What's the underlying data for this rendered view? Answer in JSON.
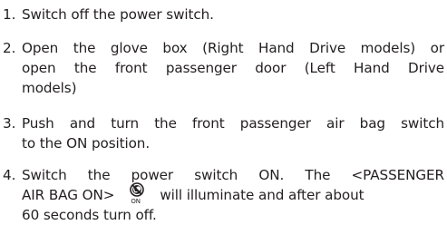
{
  "steps": [
    {
      "number": "1.",
      "lines": [
        "Switch off the power switch."
      ]
    },
    {
      "number": "2.",
      "lines": [
        "Open the glove box (Right Hand Drive models) or",
        "open the front passenger door (Left Hand Drive",
        "models)"
      ]
    },
    {
      "number": "3.",
      "lines": [
        "Push and turn the front passenger air bag switch",
        "to the ON position."
      ]
    },
    {
      "number": "4.",
      "lines": [
        "Switch the power switch ON. The <PASSENGER",
        "AIR BAG ON>",
        "will illuminate and after about",
        "60 seconds turn off."
      ],
      "indicator_label": "ON",
      "indicator_icon": "passenger-airbag-on-icon"
    }
  ]
}
